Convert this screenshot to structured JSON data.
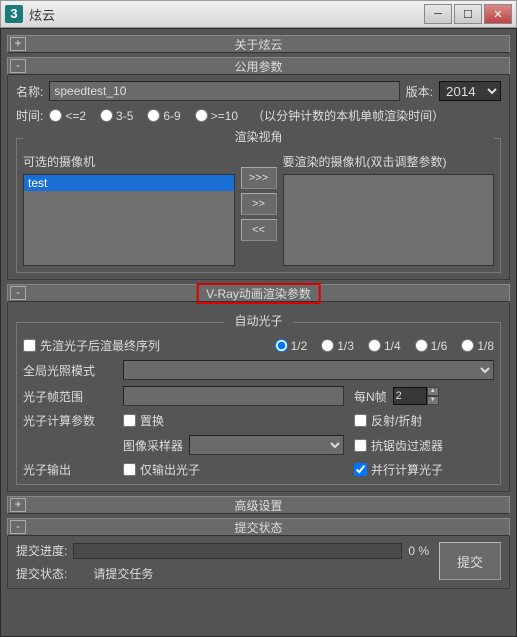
{
  "window": {
    "title": "炫云",
    "icon_text": "3"
  },
  "sections": {
    "about": {
      "title": "关于炫云",
      "toggle": "+"
    },
    "common": {
      "title": "公用参数",
      "toggle": "-",
      "name_label": "名称:",
      "name_value": "speedtest_10",
      "version_label": "版本:",
      "version_value": "2014",
      "time_label": "时间:",
      "time_options": [
        "<=2",
        "3-5",
        "6-9",
        ">=10"
      ],
      "time_note": "（以分钟计数的本机单帧渲染时间）"
    },
    "render_view": {
      "title": "渲染视角",
      "avail_label": "可选的摄像机",
      "target_label": "要渲染的摄像机(双击调整参数)",
      "avail_items": [
        "test"
      ],
      "btn_all": ">>>",
      "btn_add": ">>",
      "btn_remove": "<<"
    },
    "vray": {
      "title": "V-Ray动画渲染参数",
      "toggle": "-",
      "auto_photon_title": "自动光子",
      "pre_seq_label": "先渲光子后渲最终序列",
      "ratio_options": [
        "1/2",
        "1/3",
        "1/4",
        "1/6",
        "1/8"
      ],
      "gi_mode_label": "全局光照模式",
      "photon_range_label": "光子帧范围",
      "per_n_label": "每N帧",
      "per_n_value": "2",
      "calc_param_label": "光子计算参数",
      "displacement_label": "置换",
      "refl_refr_label": "反射/折射",
      "sampler_label": "图像采样器",
      "aa_filter_label": "抗锯齿过滤器",
      "photon_out_label": "光子输出",
      "only_photon_label": "仅输出光子",
      "parallel_label": "并行计算光子"
    },
    "advanced": {
      "title": "高级设置",
      "toggle": "+"
    },
    "submit": {
      "title": "提交状态",
      "toggle": "-",
      "progress_label": "提交进度:",
      "progress_value": "0 %",
      "status_label": "提交状态:",
      "status_value": "请提交任务",
      "submit_btn": "提交"
    }
  }
}
